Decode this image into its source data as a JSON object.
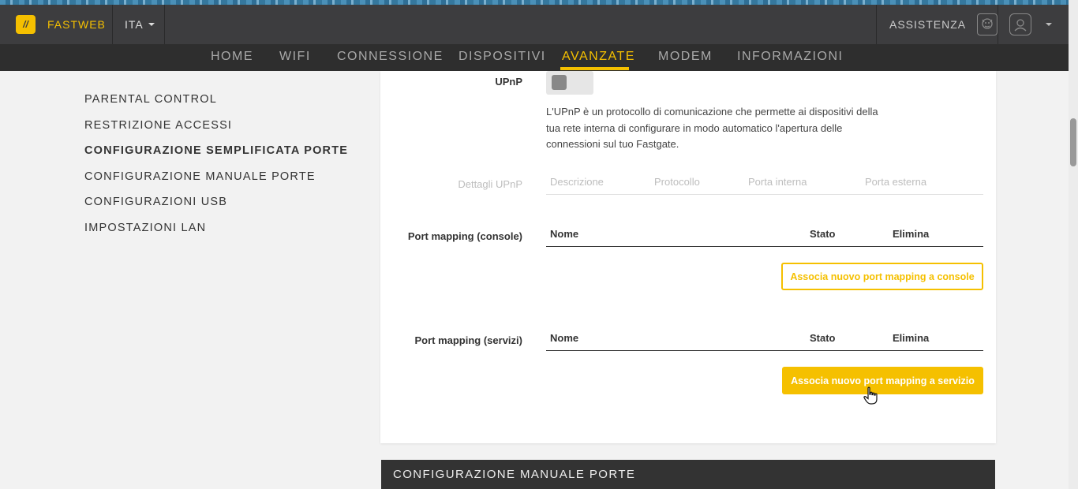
{
  "header": {
    "brand": "FASTWEB",
    "language": "ITA",
    "assistance": "ASSISTENZA"
  },
  "nav": {
    "items": [
      "HOME",
      "WIFI",
      "CONNESSIONE",
      "DISPOSITIVI",
      "AVANZATE",
      "MODEM",
      "INFORMAZIONI"
    ],
    "active": "AVANZATE"
  },
  "sidebar": {
    "items": [
      "PARENTAL CONTROL",
      "RESTRIZIONE ACCESSI",
      "CONFIGURAZIONE SEMPLIFICATA PORTE",
      "CONFIGURAZIONE MANUALE PORTE",
      "CONFIGURAZIONI USB",
      "IMPOSTAZIONI LAN"
    ],
    "active": "CONFIGURAZIONE SEMPLIFICATA PORTE"
  },
  "upnp": {
    "label": "UPnP",
    "enabled": false,
    "description": "L'UPnP è un protocollo di comunicazione che permette ai dispositivi della tua rete interna di configurare in modo automatico l'apertura delle connessioni sul tuo Fastgate.",
    "details_label": "Dettagli UPnP",
    "details_columns": [
      "Descrizione",
      "Protocollo",
      "Porta interna",
      "Porta esterna"
    ]
  },
  "console_mapping": {
    "label": "Port mapping (console)",
    "columns": [
      "Nome",
      "Stato",
      "Elimina"
    ],
    "button": "Associa nuovo port mapping a console"
  },
  "service_mapping": {
    "label": "Port mapping (servizi)",
    "columns": [
      "Nome",
      "Stato",
      "Elimina"
    ],
    "button": "Associa nuovo port mapping a servizio"
  },
  "next_section": {
    "title": "CONFIGURAZIONE MANUALE PORTE"
  },
  "colors": {
    "accent": "#f5c000",
    "header_bg": "#3d3d3f",
    "nav_bg": "#2e2e2e"
  }
}
